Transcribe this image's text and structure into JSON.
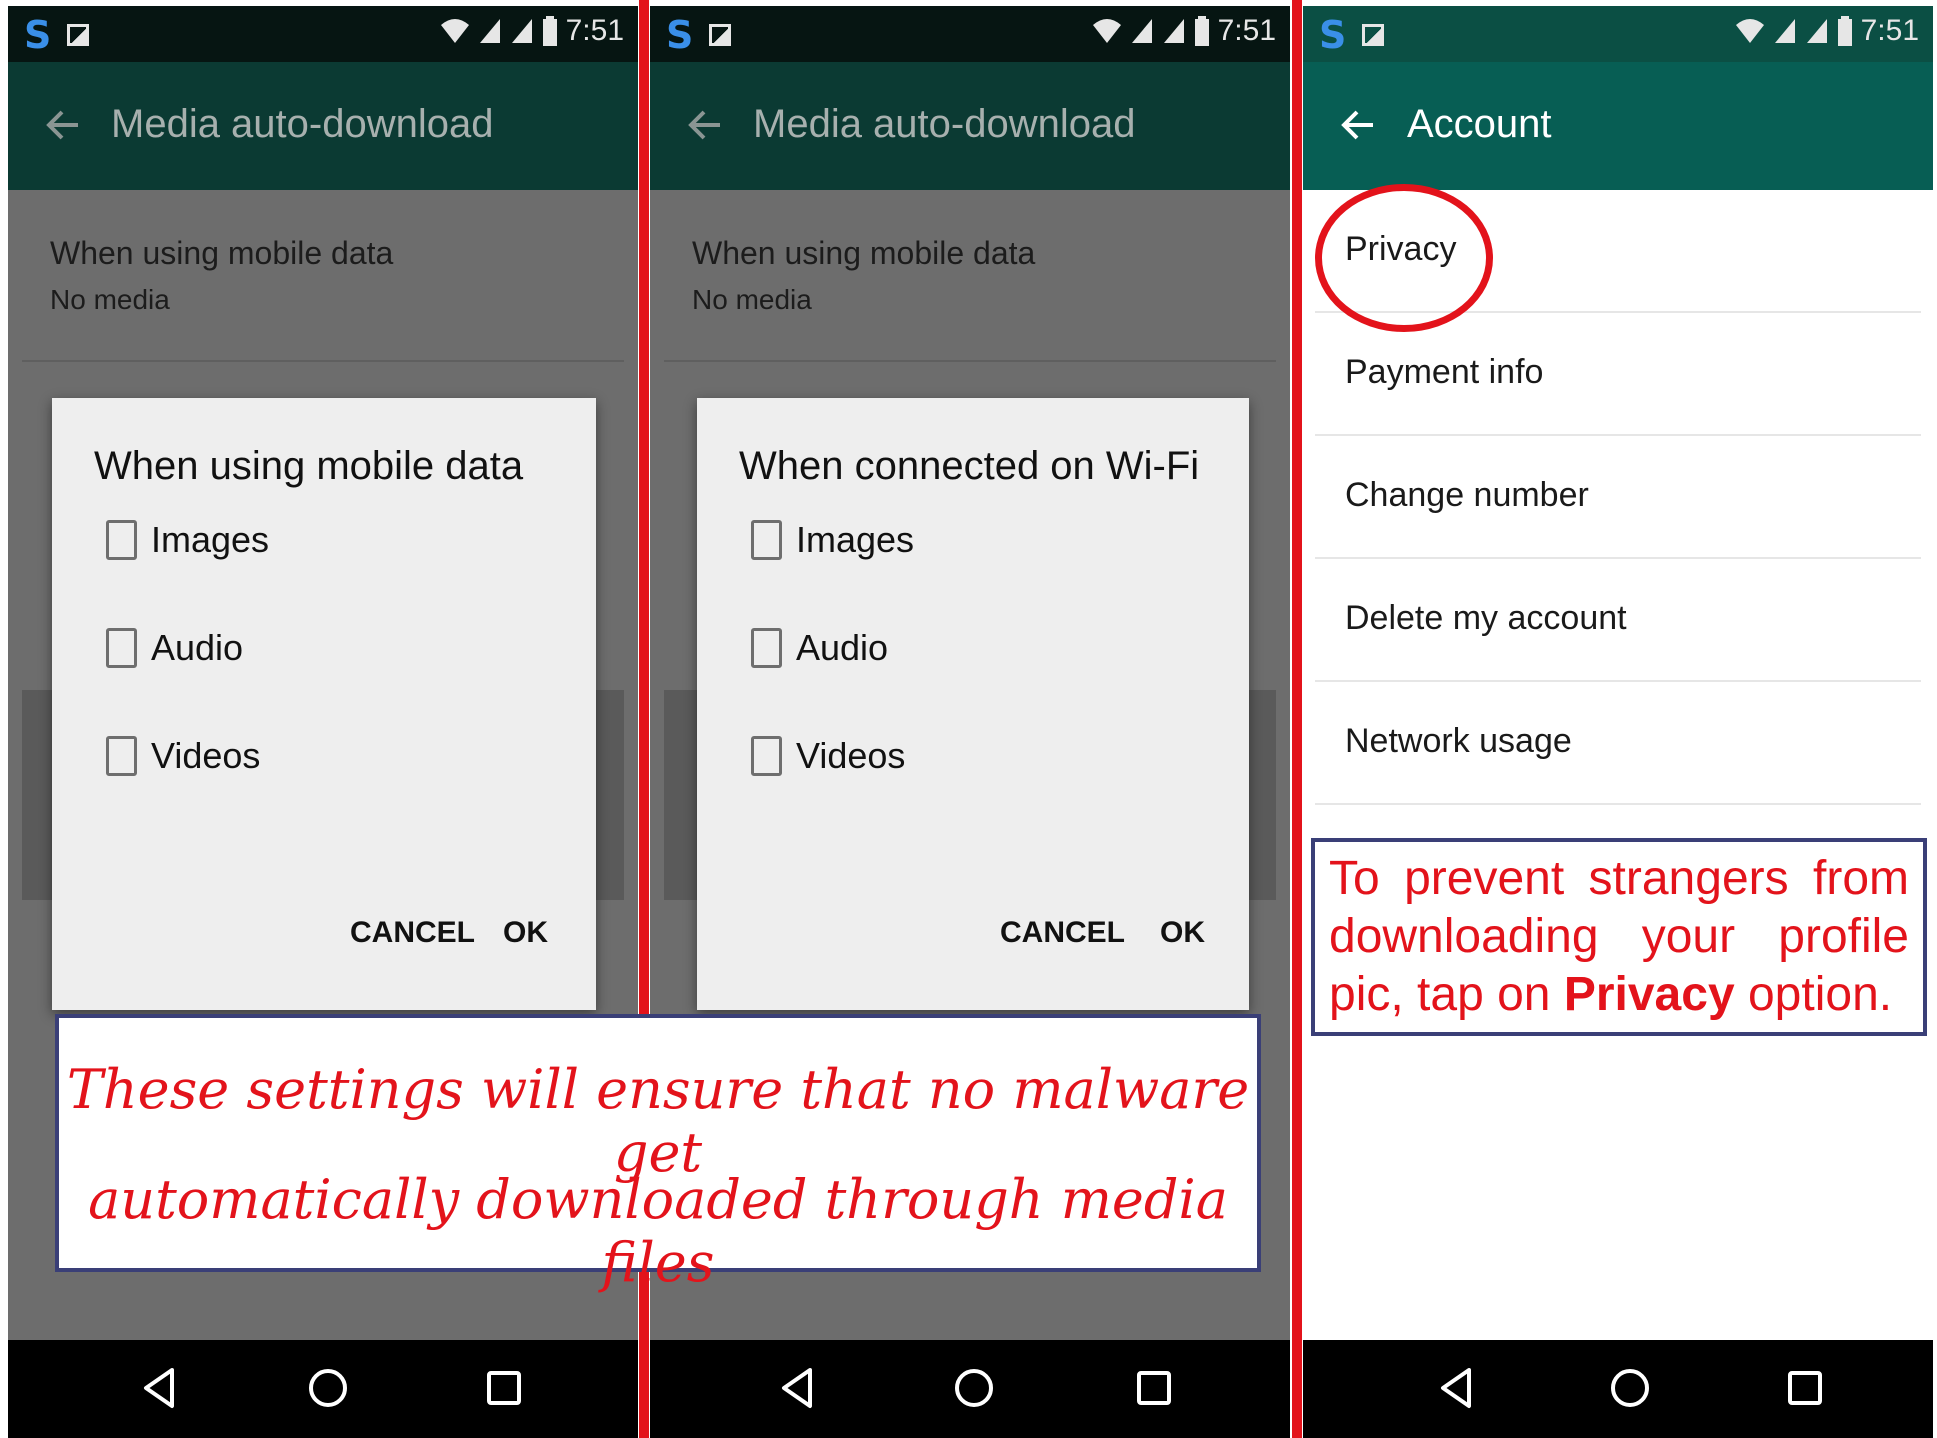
{
  "status_bar": {
    "time": "7:51"
  },
  "panel_left": {
    "app_title": "Media auto-download",
    "setting": {
      "title": "When using mobile data",
      "value": "No media"
    },
    "dialog": {
      "title": "When using mobile data",
      "options": [
        "Images",
        "Audio",
        "Videos"
      ],
      "cancel_label": "CANCEL",
      "ok_label": "OK"
    }
  },
  "panel_middle": {
    "app_title": "Media auto-download",
    "setting": {
      "title": "When using mobile data",
      "value": "No media"
    },
    "dialog": {
      "title": "When connected on Wi-Fi",
      "options": [
        "Images",
        "Audio",
        "Videos"
      ],
      "cancel_label": "CANCEL",
      "ok_label": "OK"
    }
  },
  "panel_right": {
    "app_title": "Account",
    "items": [
      "Privacy",
      "Payment info",
      "Change number",
      "Delete my account",
      "Network usage"
    ],
    "note": {
      "line1": "To prevent strangers from",
      "line2": "downloading your profile",
      "line3_before": "pic, tap on ",
      "line3_bold": "Privacy",
      "line3_after": " option."
    }
  },
  "callout": {
    "line1": "These settings will ensure that no malware get",
    "line2": "automatically downloaded through media files"
  },
  "colors": {
    "accent_red": "#e3131b",
    "whatsapp_green": "#075e54",
    "frame_blue": "#3a3f77"
  }
}
